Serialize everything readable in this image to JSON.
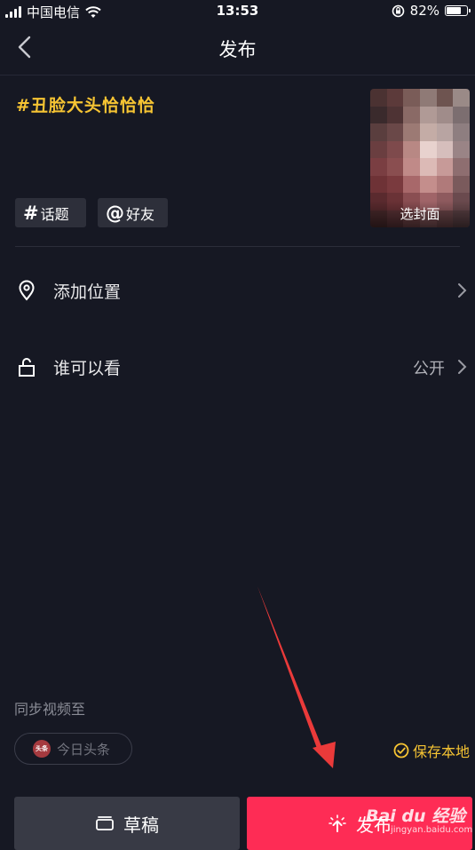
{
  "status_bar": {
    "carrier": "中国电信",
    "time": "13:53",
    "battery": "82%",
    "battery_level": 0.82
  },
  "header": {
    "title": "发布"
  },
  "caption": "#丑脸大头恰恰恰",
  "cover": {
    "label": "选封面"
  },
  "chips": {
    "topic": "话题",
    "mention": "好友"
  },
  "rows": {
    "location": {
      "label": "添加位置"
    },
    "privacy": {
      "label": "谁可以看",
      "value": "公开"
    }
  },
  "sync": {
    "title": "同步视频至",
    "toutiao": "今日头条",
    "toutiao_badge": "头条",
    "save_local": "保存本地"
  },
  "buttons": {
    "draft": "草稿",
    "publish": "发布"
  },
  "watermark": {
    "brand": "Bai du 经验",
    "url": "jingyan.baidu.com"
  },
  "colors": {
    "accent_yellow": "#f6c433",
    "publish_red": "#fe2c55",
    "background": "#161823"
  }
}
